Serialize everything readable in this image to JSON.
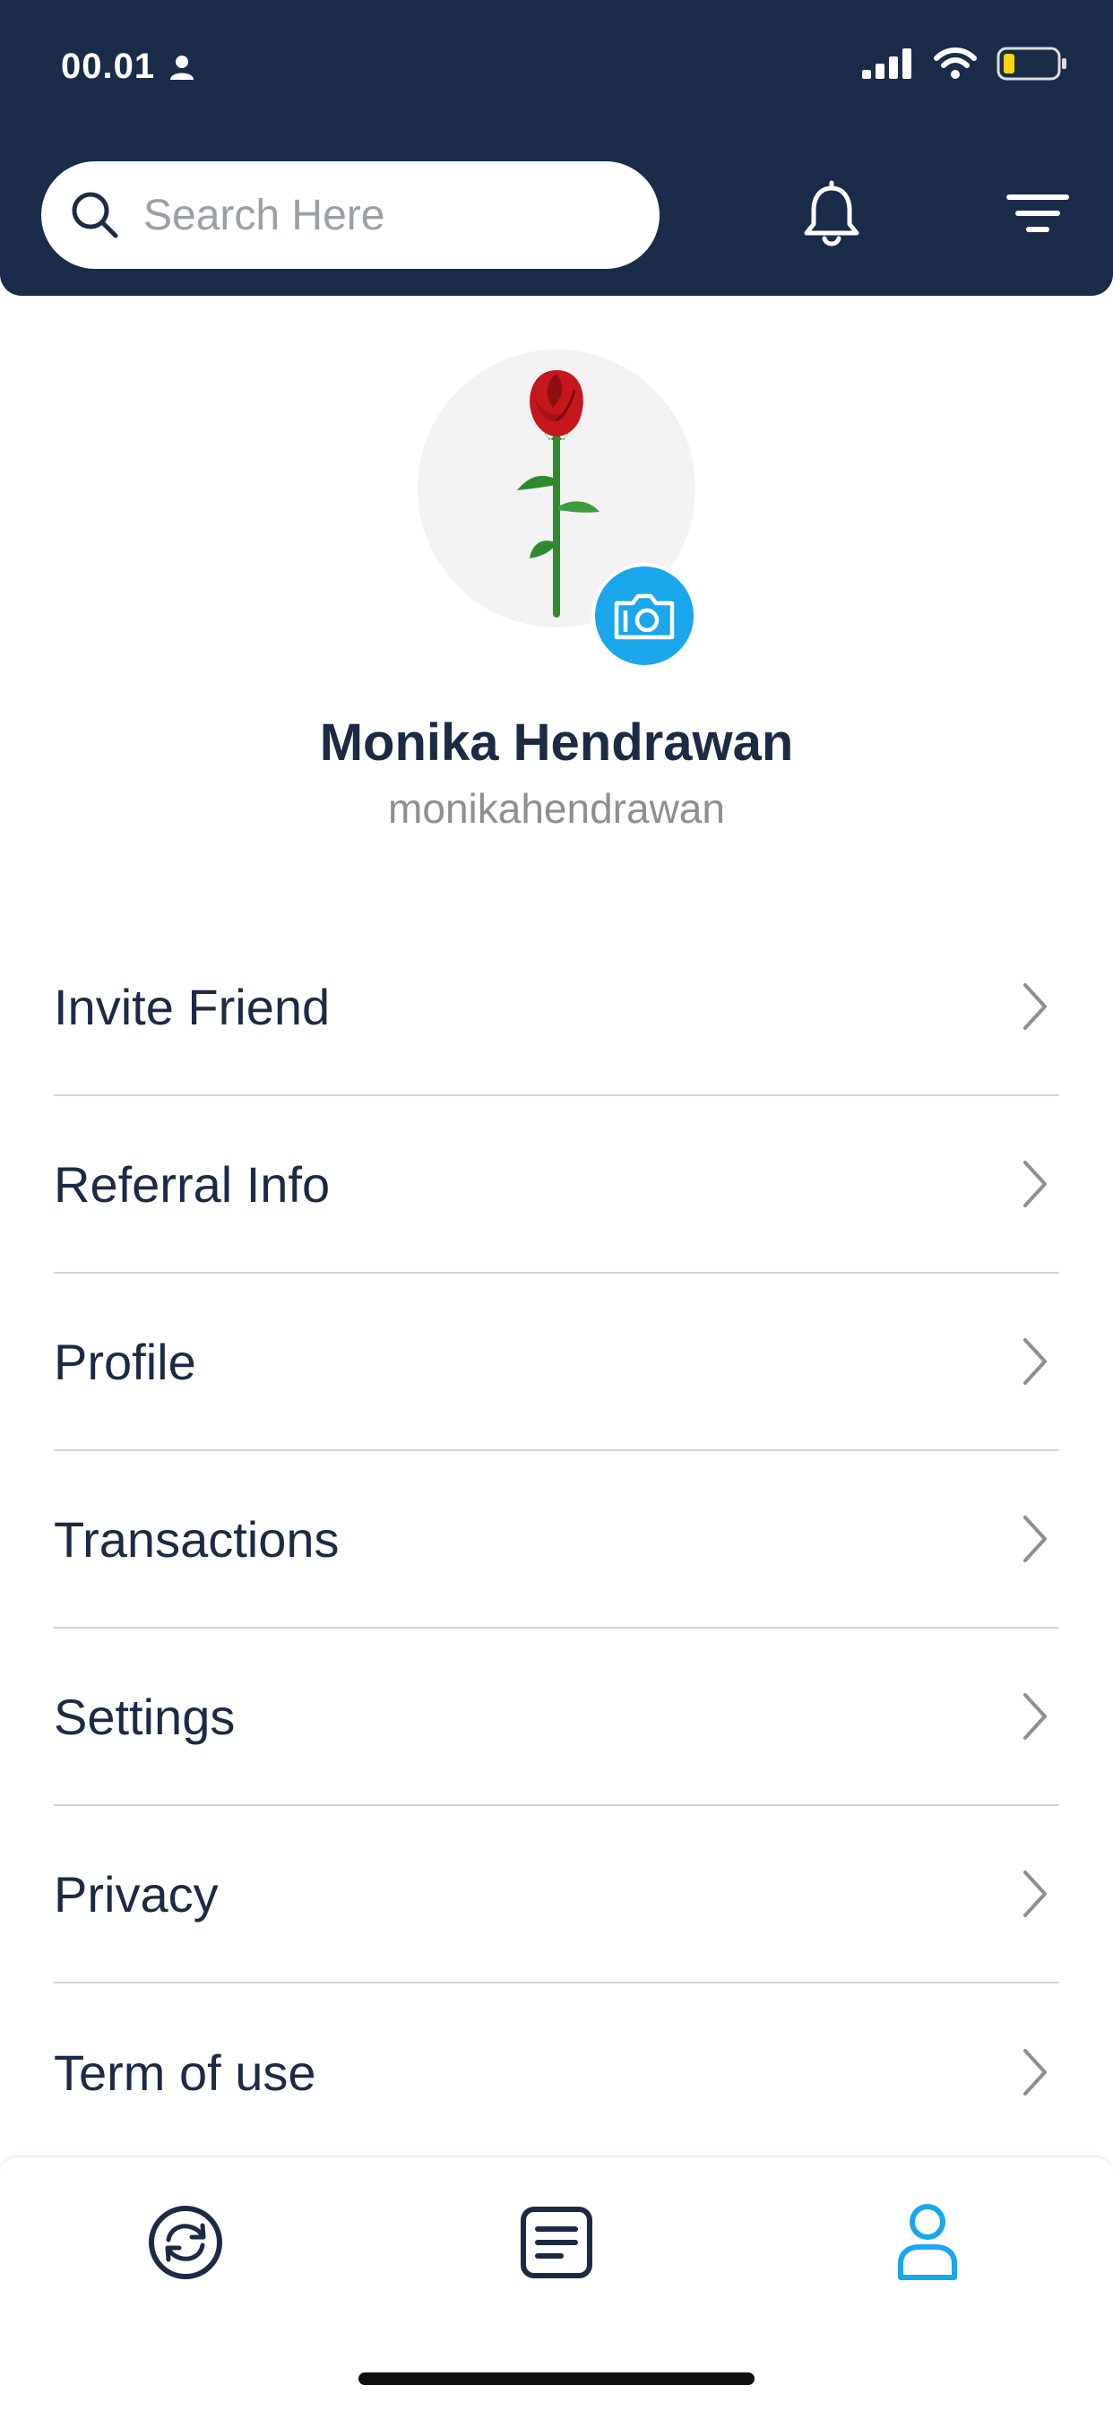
{
  "status_bar": {
    "time": "00.01",
    "icons": [
      "person-icon",
      "signal-icon",
      "wifi-icon",
      "battery-icon"
    ]
  },
  "header": {
    "search": {
      "placeholder": "Search Here",
      "value": ""
    },
    "icons": [
      "search-icon",
      "bell-icon",
      "filter-icon"
    ]
  },
  "profile": {
    "name": "Monika Hendrawan",
    "username": "monikahendrawan",
    "avatar": "rose",
    "camera_icon": "camera-icon"
  },
  "menu": {
    "items": [
      {
        "label": "Invite Friend"
      },
      {
        "label": "Referral Info"
      },
      {
        "label": "Profile"
      },
      {
        "label": "Transactions"
      },
      {
        "label": "Settings"
      },
      {
        "label": "Privacy"
      },
      {
        "label": "Term of use"
      }
    ]
  },
  "tabbar": {
    "tabs": [
      {
        "icon": "sync-icon",
        "active": false
      },
      {
        "icon": "list-icon",
        "active": false
      },
      {
        "icon": "user-icon",
        "active": true
      }
    ]
  },
  "colors": {
    "header_bg": "#1a2c4a",
    "text_primary": "#1d2a44",
    "text_secondary": "#8e8e93",
    "accent": "#1aa7ec",
    "divider": "#d5d5d8"
  }
}
